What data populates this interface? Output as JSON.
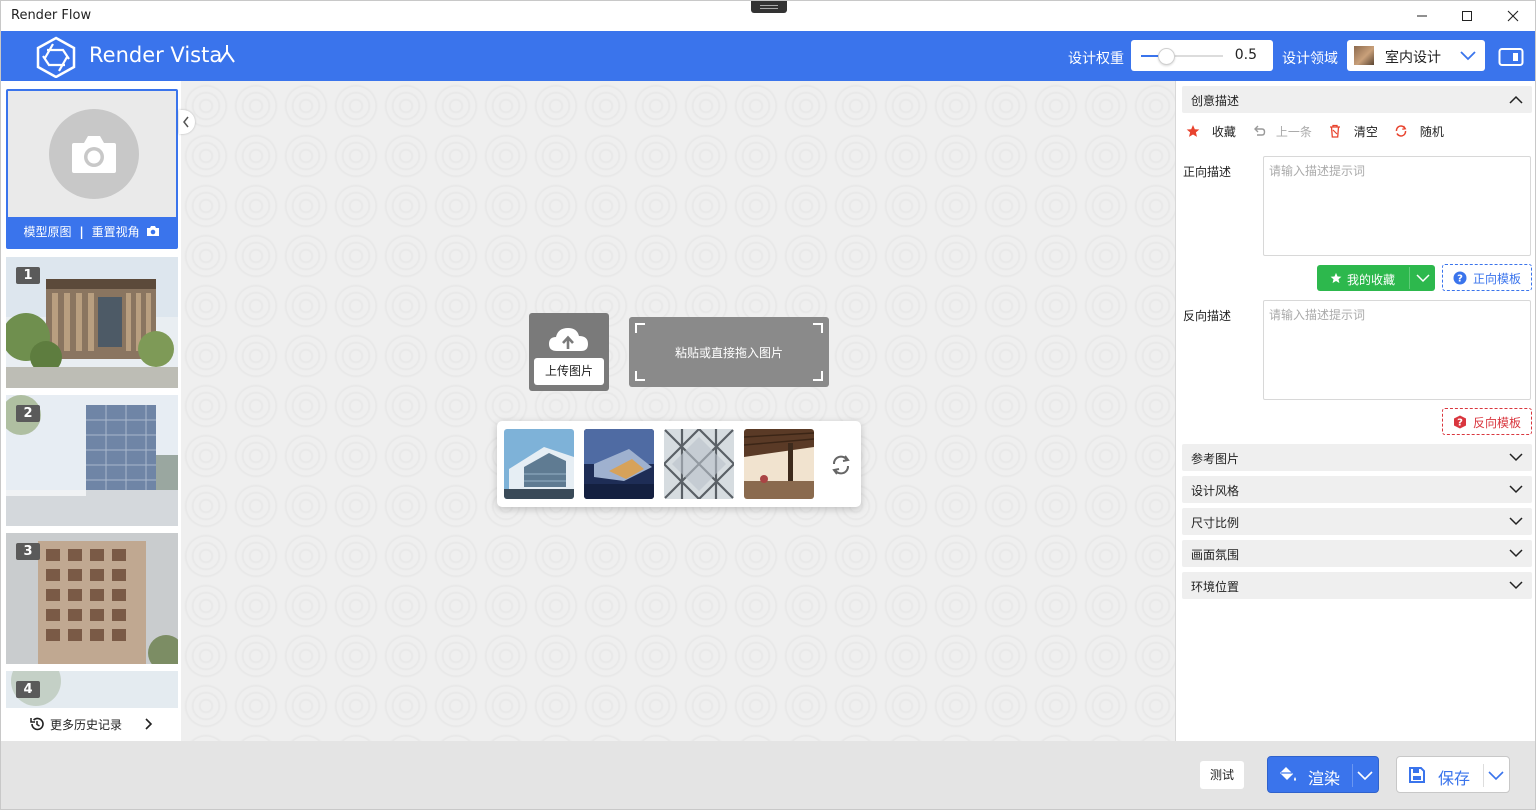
{
  "window": {
    "title": "Render Flow"
  },
  "header": {
    "brand": "Render Vista",
    "weight_label": "设计权重",
    "weight_value": "0.5",
    "weight_fraction": 0.3,
    "domain_label": "设计领域",
    "domain_value": "室内设计",
    "accent_color": "#3a74ec"
  },
  "left": {
    "original_label": "模型原图",
    "reset_view_label": "重置视角",
    "history": [
      {
        "index": "1"
      },
      {
        "index": "2"
      },
      {
        "index": "3"
      },
      {
        "index": "4"
      }
    ],
    "more_history": "更多历史记录"
  },
  "canvas": {
    "upload_label": "上传图片",
    "paste_label": "粘贴或直接拖入图片"
  },
  "right": {
    "creative_section": "创意描述",
    "actions": {
      "favorite": "收藏",
      "previous": "上一条",
      "clear": "清空",
      "random": "随机"
    },
    "positive_label": "正向描述",
    "positive_placeholder": "请输入描述提示词",
    "my_favorites": "我的收藏",
    "positive_template": "正向模板",
    "negative_label": "反向描述",
    "negative_placeholder": "请输入描述提示词",
    "negative_template": "反向模板",
    "sections": [
      "参考图片",
      "设计风格",
      "尺寸比例",
      "画面氛围",
      "环境位置"
    ]
  },
  "bottom": {
    "test_label": "测试",
    "render_label": "渲染",
    "save_label": "保存"
  }
}
